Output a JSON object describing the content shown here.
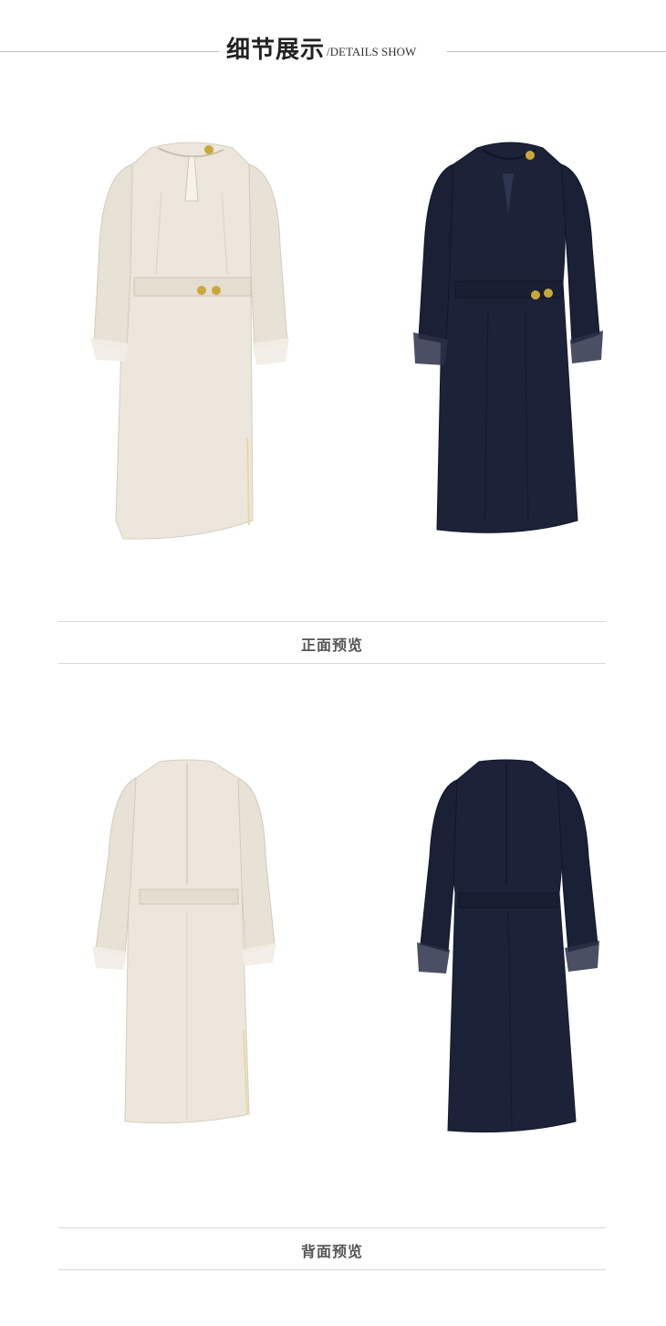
{
  "header": {
    "title_zh": "细节展示",
    "title_en": "/DETAILS SHOW"
  },
  "sections": [
    {
      "caption": "正面预览"
    },
    {
      "caption": "背面预览"
    }
  ],
  "colors": {
    "ivory_dress": "#ece6dc",
    "navy_dress": "#1c2238",
    "button_gold": "#c9a83a",
    "divider": "#d9d9d9"
  }
}
